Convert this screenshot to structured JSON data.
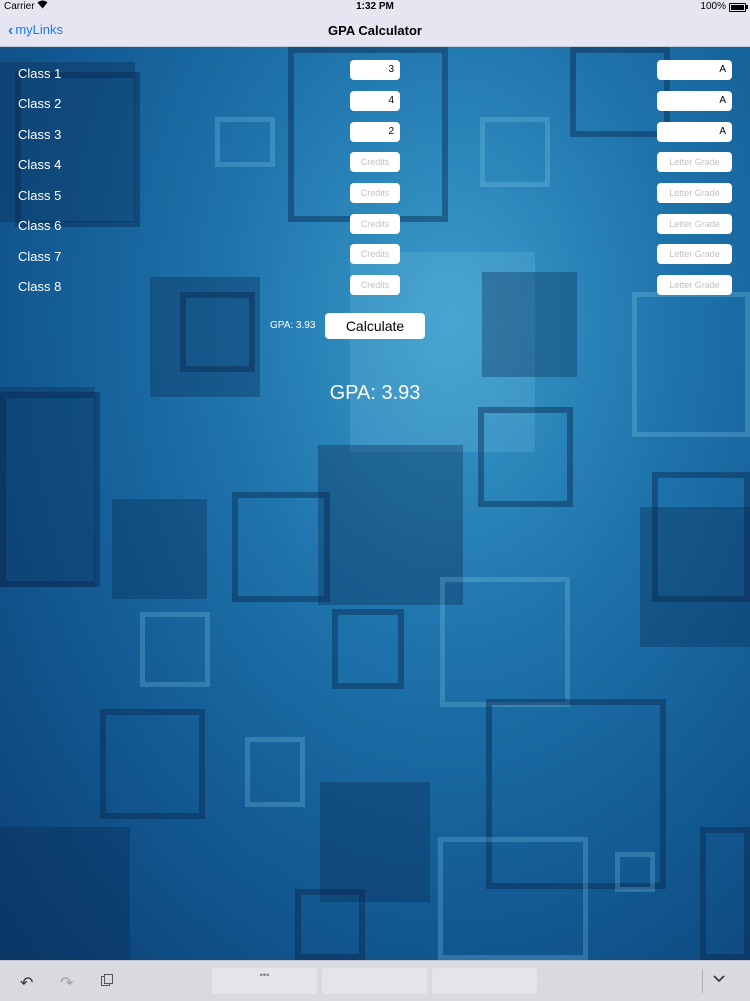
{
  "status": {
    "carrier": "Carrier",
    "time": "1:32 PM",
    "battery": "100%"
  },
  "nav": {
    "back_label": "myLinks",
    "title": "GPA Calculator"
  },
  "classes": [
    {
      "label": "Class 1",
      "credits": "3",
      "grade": "A"
    },
    {
      "label": "Class 2",
      "credits": "4",
      "grade": "A"
    },
    {
      "label": "Class 3",
      "credits": "2",
      "grade": "A"
    },
    {
      "label": "Class 4",
      "credits": "",
      "grade": ""
    },
    {
      "label": "Class 5",
      "credits": "",
      "grade": ""
    },
    {
      "label": "Class 6",
      "credits": "",
      "grade": ""
    },
    {
      "label": "Class 7",
      "credits": "",
      "grade": ""
    },
    {
      "label": "Class 8",
      "credits": "",
      "grade": ""
    }
  ],
  "placeholders": {
    "credits": "Credits",
    "grade": "Letter Grade"
  },
  "result": {
    "small_label": "GPA: 3.93",
    "calculate_label": "Calculate",
    "big_label": "GPA: 3.93"
  },
  "toolbar": {
    "key_dots": "•••"
  },
  "colors": {
    "accent": "#1a7cf5",
    "background": "#1f74ac"
  }
}
